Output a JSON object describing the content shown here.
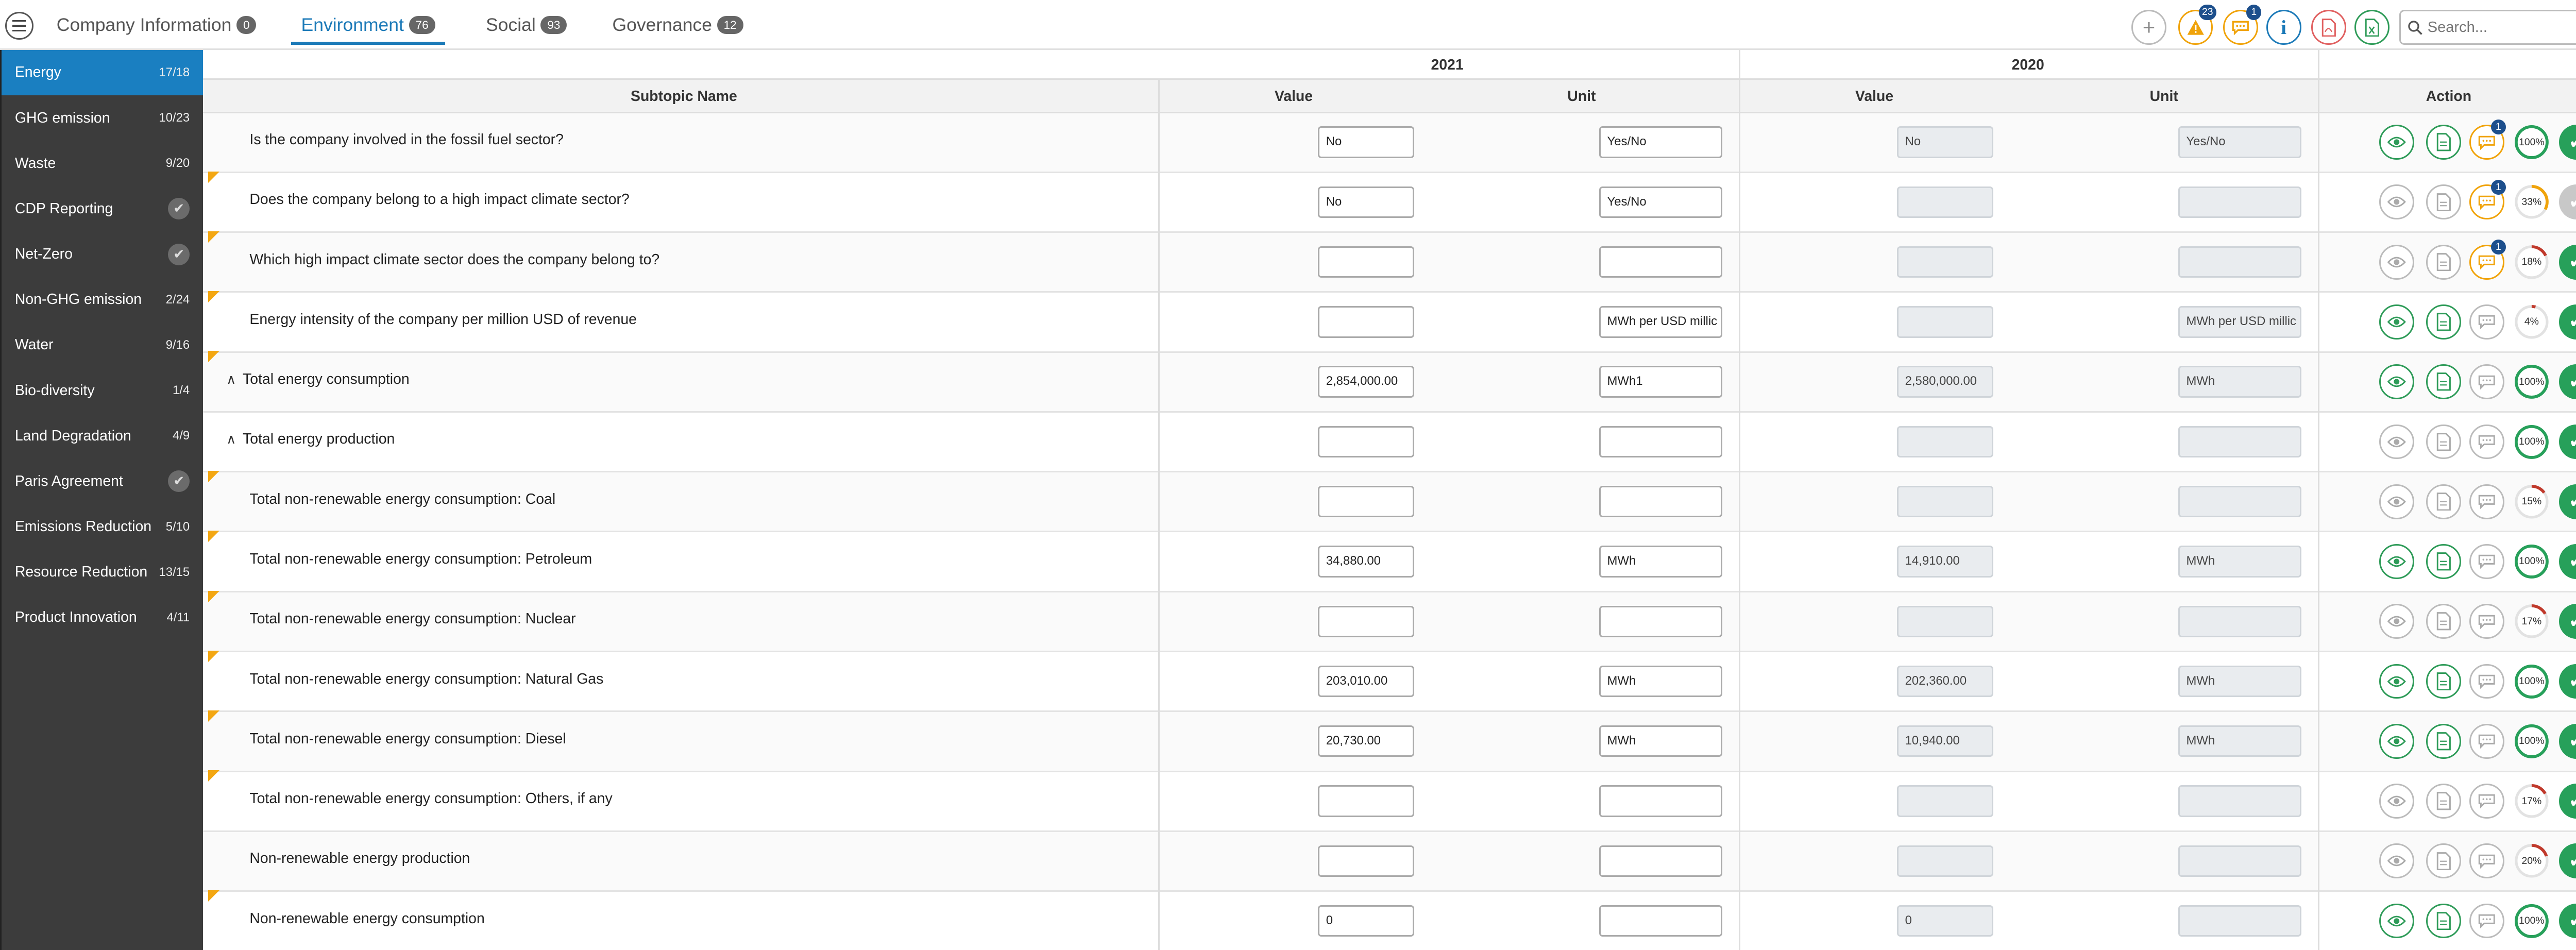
{
  "tabs": [
    {
      "label": "Company Information",
      "count": "0"
    },
    {
      "label": "Environment",
      "count": "76",
      "active": true
    },
    {
      "label": "Social",
      "count": "93"
    },
    {
      "label": "Governance",
      "count": "12"
    }
  ],
  "toolbar": {
    "alerts_count": "23",
    "comments_count": "1",
    "search_placeholder": "Search..."
  },
  "sidebar": [
    {
      "label": "Energy",
      "count": "17/18",
      "active": true
    },
    {
      "label": "GHG emission",
      "count": "10/23"
    },
    {
      "label": "Waste",
      "count": "9/20"
    },
    {
      "label": "CDP Reporting",
      "done": true
    },
    {
      "label": "Net-Zero",
      "done": true
    },
    {
      "label": "Non-GHG emission",
      "count": "2/24"
    },
    {
      "label": "Water",
      "count": "9/16"
    },
    {
      "label": "Bio-diversity",
      "count": "1/4"
    },
    {
      "label": "Land Degradation",
      "count": "4/9"
    },
    {
      "label": "Paris Agreement",
      "done": true
    },
    {
      "label": "Emissions Reduction",
      "count": "5/10"
    },
    {
      "label": "Resource Reduction",
      "count": "13/15"
    },
    {
      "label": "Product Innovation",
      "count": "4/11"
    }
  ],
  "table": {
    "year_current": "2021",
    "year_previous": "2020",
    "headers": {
      "subtopic": "Subtopic Name",
      "value": "Value",
      "unit": "Unit",
      "action": "Action"
    },
    "rows": [
      {
        "label": "Is the company involved in the fossil fuel sector?",
        "v21": "No",
        "u21": "Yes/No",
        "v20": "No",
        "u20": "Yes/No",
        "state": "g",
        "comment": "o",
        "comment_badge": "1",
        "progress": 100,
        "progress_label": "100%",
        "done": true,
        "flag": false,
        "caret": false
      },
      {
        "label": "Does the company belong to a high impact climate sector?",
        "v21": "No",
        "u21": "Yes/No",
        "v20": "",
        "u20": "",
        "state": "n",
        "comment": "o",
        "comment_badge": "1",
        "progress": 33,
        "progress_label": "33%",
        "done": false,
        "flag": true,
        "caret": false
      },
      {
        "label": "Which high impact climate sector does the company belong to?",
        "v21": "",
        "u21": "",
        "v20": "",
        "u20": "",
        "state": "n",
        "comment": "o",
        "comment_badge": "1",
        "progress": 18,
        "progress_label": "18%",
        "done": true,
        "flag": true,
        "caret": false
      },
      {
        "label": "Energy intensity of the company per million USD of revenue",
        "v21": "",
        "u21": "MWh per USD millic",
        "v20": "",
        "u20": "MWh per USD millic",
        "state": "g",
        "comment": "n",
        "comment_badge": "",
        "progress": 4,
        "progress_label": "4%",
        "done": true,
        "flag": true,
        "caret": false
      },
      {
        "label": "Total energy consumption",
        "v21": "2,854,000.00",
        "u21": "MWh1",
        "v20": "2,580,000.00",
        "u20": "MWh",
        "state": "g",
        "comment": "n",
        "comment_badge": "",
        "progress": 100,
        "progress_label": "100%",
        "done": true,
        "flag": true,
        "caret": true
      },
      {
        "label": "Total energy production",
        "v21": "",
        "u21": "",
        "v20": "",
        "u20": "",
        "state": "n",
        "comment": "n",
        "comment_badge": "",
        "progress": 100,
        "progress_label": "100%",
        "done": true,
        "flag": false,
        "caret": true
      },
      {
        "label": "Total non-renewable energy consumption: Coal",
        "v21": "",
        "u21": "",
        "v20": "",
        "u20": "",
        "state": "n",
        "comment": "n",
        "comment_badge": "",
        "progress": 15,
        "progress_label": "15%",
        "done": true,
        "flag": true,
        "caret": false
      },
      {
        "label": "Total non-renewable energy consumption: Petroleum",
        "v21": "34,880.00",
        "u21": "MWh",
        "v20": "14,910.00",
        "u20": "MWh",
        "state": "g",
        "comment": "n",
        "comment_badge": "",
        "progress": 100,
        "progress_label": "100%",
        "done": true,
        "flag": true,
        "caret": false
      },
      {
        "label": "Total non-renewable energy consumption: Nuclear",
        "v21": "",
        "u21": "",
        "v20": "",
        "u20": "",
        "state": "n",
        "comment": "n",
        "comment_badge": "",
        "progress": 17,
        "progress_label": "17%",
        "done": true,
        "flag": true,
        "caret": false
      },
      {
        "label": "Total non-renewable energy consumption: Natural Gas",
        "v21": "203,010.00",
        "u21": "MWh",
        "v20": "202,360.00",
        "u20": "MWh",
        "state": "g",
        "comment": "n",
        "comment_badge": "",
        "progress": 100,
        "progress_label": "100%",
        "done": true,
        "flag": true,
        "caret": false
      },
      {
        "label": "Total non-renewable energy consumption: Diesel",
        "v21": "20,730.00",
        "u21": "MWh",
        "v20": "10,940.00",
        "u20": "MWh",
        "state": "g",
        "comment": "n",
        "comment_badge": "",
        "progress": 100,
        "progress_label": "100%",
        "done": true,
        "flag": true,
        "caret": false
      },
      {
        "label": "Total non-renewable energy consumption: Others, if any",
        "v21": "",
        "u21": "",
        "v20": "",
        "u20": "",
        "state": "n",
        "comment": "n",
        "comment_badge": "",
        "progress": 17,
        "progress_label": "17%",
        "done": true,
        "flag": true,
        "caret": false
      },
      {
        "label": "Non-renewable energy production",
        "v21": "",
        "u21": "",
        "v20": "",
        "u20": "",
        "state": "n",
        "comment": "n",
        "comment_badge": "",
        "progress": 20,
        "progress_label": "20%",
        "done": true,
        "flag": false,
        "caret": false
      },
      {
        "label": "Non-renewable energy consumption",
        "v21": "0",
        "u21": "",
        "v20": "0",
        "u20": "",
        "state": "g",
        "comment": "n",
        "comment_badge": "",
        "progress": 100,
        "progress_label": "100%",
        "done": true,
        "flag": true,
        "caret": false
      }
    ]
  },
  "colors": {
    "accent": "#1a7fc1",
    "success": "#27a05a",
    "warning": "#f0a30a",
    "progress_low": "#c0392b"
  }
}
